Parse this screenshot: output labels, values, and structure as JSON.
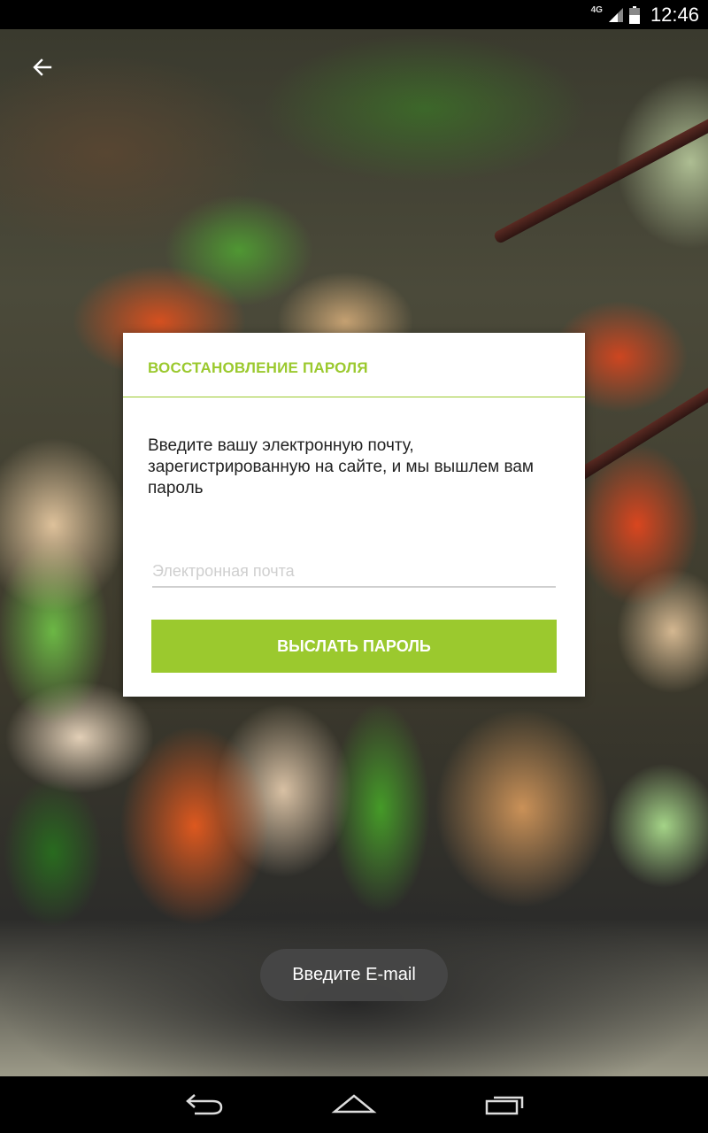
{
  "status_bar": {
    "network": "4G",
    "time": "12:46"
  },
  "dialog": {
    "title": "ВОССТАНОВЛЕНИЕ ПАРОЛЯ",
    "message": "Введите вашу электронную почту, зарегистрированную на сайте, и мы вышлем вам пароль",
    "email_placeholder": "Электронная почта",
    "email_value": "",
    "send_label": "ВЫСЛАТЬ ПАРОЛЬ"
  },
  "toast": {
    "text": "Введите E-mail"
  },
  "colors": {
    "accent": "#9bc92e",
    "toast_bg": "#464646"
  },
  "icons": {
    "back": "arrow-back-icon",
    "nav_back": "nav-back-icon",
    "nav_home": "nav-home-icon",
    "nav_recents": "nav-recents-icon"
  }
}
